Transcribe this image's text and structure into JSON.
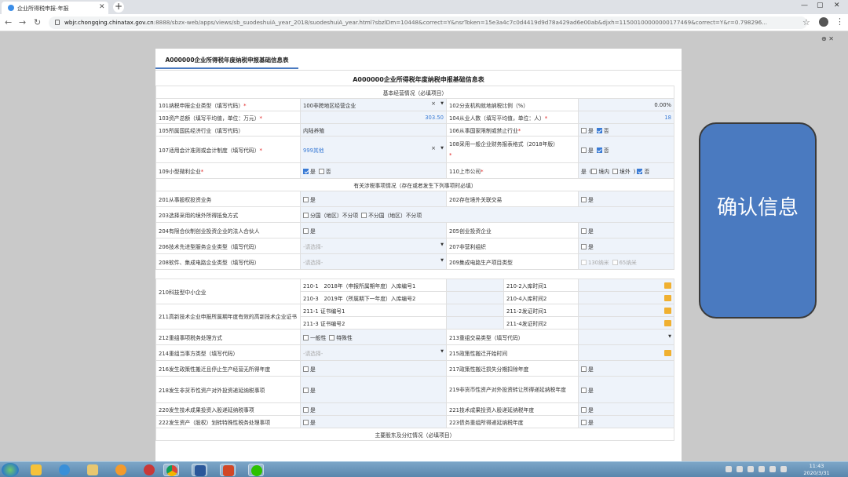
{
  "browser": {
    "tab_title": "企业所得税申报-年报",
    "url_host": "wbjr.chongqing.chinatax.gov.cn",
    "url_rest": ":8888/sbzx-web/apps/views/sb_suodeshuiA_year_2018/suodeshuiA_year.html?sbzlDm=10448&correct=Y&nsrToken=15e3a4c7c0d4419d9d78a429ad6e00ab&djxh=11500100000000177469&correct=Y&r=0.798296..."
  },
  "page": {
    "tab_label": "A000000企业所得税年度纳税申报基础信息表",
    "form_title": "A000000企业所得税年度纳税申报基础信息表",
    "section_basic": "基本经营情况（必填项目）",
    "section_related": "有关涉税事项情况（存在或者发生下列事项时必填）",
    "section_shareholders": "主要股东及分红情况（必填项目）"
  },
  "fields": {
    "f101_label": "101纳税申报企业类型（填写代码）",
    "f101_value": "100非跨地区经营企业",
    "f102_label": "102分支机构就地纳税比例（%）",
    "f102_value": "0.00%",
    "f103_label": "103资产总额（填写平均值，单位：万元）",
    "f103_value": "303.50",
    "f104_label": "104从业人数（填写平均值，单位：人）",
    "f104_value": "18",
    "f105_label": "105所属国民经济行业（填写代码）",
    "f105_value": "内陆养殖",
    "f106_label": "106从事国家限制或禁止行业",
    "f107_label": "107适用会计准则或会计制度（填写代码）",
    "f107_value": "999其他",
    "f108_label": "108采用一般企业财务报表格式（2018年版）",
    "f109_label": "109小型微利企业",
    "f110_label": "110上市公司",
    "yes": "是",
    "no": "否",
    "domestic": "境内",
    "overseas": "境外",
    "f201_label": "201从事股权投资业务",
    "f202_label": "202存在境外关联交易",
    "f203_label": "203选择采用的境外所得抵免方式",
    "opt_by_country": "分国（地区）不分项",
    "opt_not_by_country": "不分国（地区）不分项",
    "f204_label": "204有限合伙制创业投资企业的法人合伙人",
    "f205_label": "205创业投资企业",
    "f206_label": "206技术先进型服务企业类型（填写代码）",
    "please_select": "-请选择-",
    "f207_label": "207非营利组织",
    "f208_label": "208软件、集成电路企业类型（填写代码）",
    "f209_label": "209集成电路生产项目类型",
    "nm130": "130纳米",
    "nm65": "65纳米",
    "f210_label": "210科技型中小企业",
    "f210_1": "210-1　2018年（申报所属期年度）入库编号1",
    "f210_2": "210-2入库时间1",
    "f210_3": "210-3　2019年（所属期下一年度）入库编号2",
    "f210_4": "210-4入库时间2",
    "f211_label": "211高新技术企业申报所属期年度有效的高新技术企业证书",
    "f211_1": "211-1 证书编号1",
    "f211_2": "211-2发证时间1",
    "f211_3": "211-3 证书编号2",
    "f211_4": "211-4发证时间2",
    "f212_label": "212重组事项税务处理方式",
    "opt_general": "一般性",
    "opt_special": "特殊性",
    "f213_label": "213重组交易类型（填写代码）",
    "f214_label": "214重组当事方类型（填写代码）",
    "f215_label": "215政策性搬迁开始时间",
    "f216_label": "216发生政策性搬迁且停止生产经营无所得年度",
    "f217_label": "217政策性搬迁损失分期扣除年度",
    "f218_label": "218发生非货币性资产对外投资递延纳税事项",
    "f219_label": "219非货币性资产对外投资转让所得递延纳税年度",
    "f220_label": "220发生技术成果投资入股递延纳税事项",
    "f221_label": "221技术成果投资入股递延纳税年度",
    "f222_label": "222发生资产（股权）划转特殊性税务处理事项",
    "f223_label": "223债务重组所得递延纳税年度"
  },
  "overlay": {
    "confirm_label": "确认信息"
  },
  "clock": {
    "time": "11:43",
    "date": "2020/3/31"
  }
}
